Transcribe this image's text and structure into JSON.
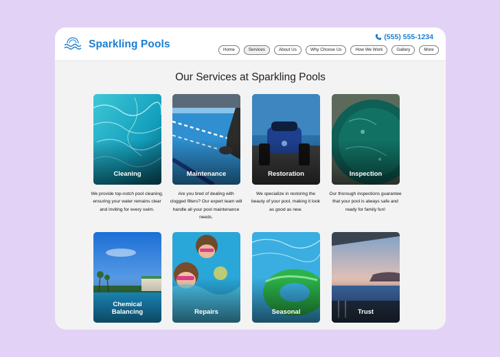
{
  "brand": {
    "name": "Sparkling Pools",
    "logo_icon": "wave-pool-logo-icon"
  },
  "header": {
    "phone": "(555) 555-1234",
    "phone_icon": "phone-icon"
  },
  "nav": [
    {
      "label": "Home",
      "active": false
    },
    {
      "label": "Services",
      "active": true
    },
    {
      "label": "About Us",
      "active": false
    },
    {
      "label": "Why Choose Us",
      "active": false
    },
    {
      "label": "How We Work",
      "active": false
    },
    {
      "label": "Gallery",
      "active": false
    },
    {
      "label": "More",
      "active": false
    }
  ],
  "main": {
    "title": "Our Services at Sparkling Pools",
    "services": [
      {
        "label": "Cleaning",
        "image": "sparkling-pool-water-photo",
        "description": "We provide top-notch pool cleaning, ensuring your water remains clear and inviting for every swim."
      },
      {
        "label": "Maintenance",
        "image": "swimmer-in-lap-pool-photo",
        "description": "Are you tired of dealing with clogged filters? Our expert team will handle all your pool maintenance needs."
      },
      {
        "label": "Restoration",
        "image": "robotic-pool-cleaner-photo",
        "description": "We specialize in restoring the beauty of your pool, making it look as good as new."
      },
      {
        "label": "Inspection",
        "image": "pool-water-closeup-photo",
        "description": "Our thorough inspections guarantee that your pool is always safe and ready for family fun!"
      },
      {
        "label": "Chemical Balancing",
        "label_line1": "Chemical",
        "label_line2": "Balancing",
        "image": "resort-pool-palms-photo"
      },
      {
        "label": "Repairs",
        "image": "children-swimming-goggles-photo"
      },
      {
        "label": "Seasonal",
        "image": "green-pool-float-photo"
      },
      {
        "label": "Trust",
        "image": "infinity-pool-sunset-photo"
      }
    ]
  },
  "colors": {
    "accent": "#1a7ed2",
    "background": "#e2d3f6",
    "frame": "#f3f3f3"
  }
}
